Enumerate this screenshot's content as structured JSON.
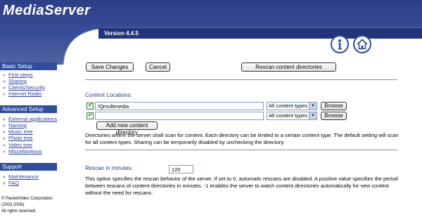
{
  "app": {
    "title": "MediaServer",
    "version": "Version 4.4.5"
  },
  "header": {
    "icons": [
      "info-icon",
      "home-icon"
    ]
  },
  "sidebar": {
    "sections": [
      {
        "title": "Basic Setup",
        "items": [
          "First steps",
          "Sharing",
          "Clients/Security",
          "Internet Radio"
        ]
      },
      {
        "title": "Advanced Setup",
        "items": [
          "External applications",
          "Naming",
          "Music tree",
          "Photo tree",
          "Video tree",
          "Miscellaneous"
        ]
      },
      {
        "title": "Support",
        "items": [
          "Maintenance",
          "FAQ"
        ]
      }
    ],
    "copyright": [
      "© PacketVideo Corporation",
      "(2003,2008).",
      "All rights reserved"
    ]
  },
  "toolbar": {
    "save_label": "Save Changes",
    "cancel_label": "Cancel",
    "rescan_label": "Rescan content directories"
  },
  "content_locations": {
    "title": "Content Locations:",
    "rows": [
      {
        "checked": true,
        "path": "/Qmultimedia",
        "type": "All content types",
        "browse": "Browse"
      },
      {
        "checked": true,
        "path": "",
        "type": "All content types",
        "browse": "Browse"
      }
    ],
    "add_label": "Add new content directory",
    "description": "Directories where the server shall scan for content. Each directory can be limited to a certain content type. The default setting will scan for all content types. Sharing can be temporarily disabled by unchecking the directory."
  },
  "rescan": {
    "label": "Rescan in minutes:",
    "value": "120",
    "description": "This option specifies the rescan behavior of the server. If set to 0, automatic rescans are disabled. A positive value specifies the period between rescans of content directories in minutes. -1 enables the server to watch content directories automatically for new content without the need for rescans."
  },
  "colors": {
    "header_blue": "#2c3f86",
    "section_blue": "#2f4da0",
    "link_blue": "#2b3f9a"
  }
}
